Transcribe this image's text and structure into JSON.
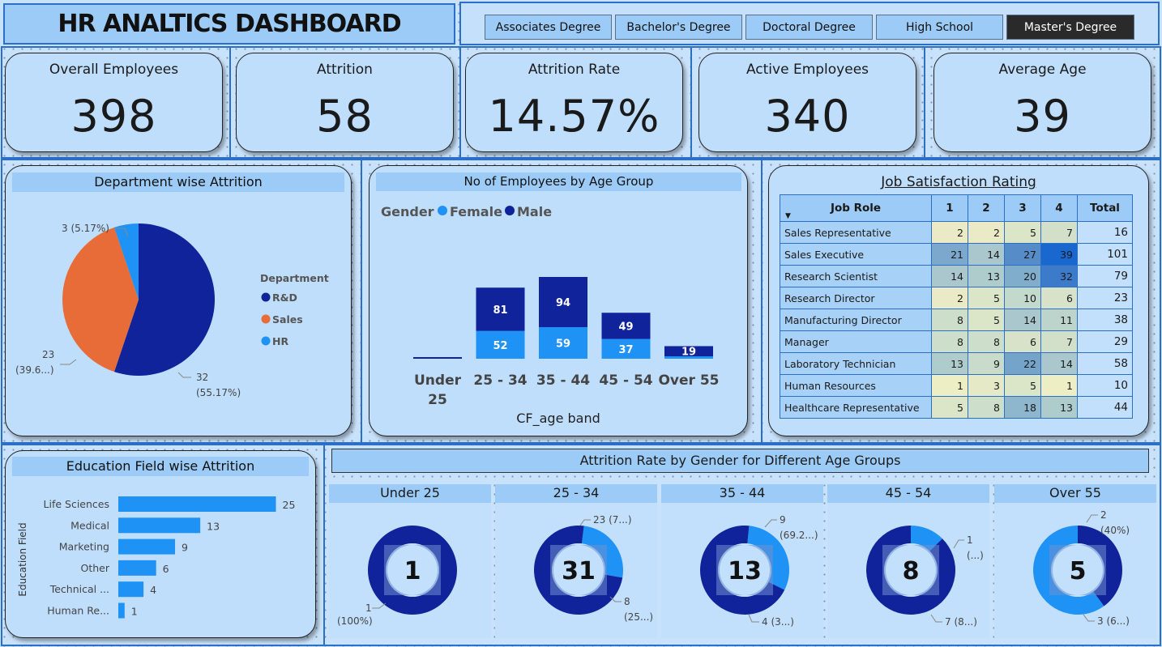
{
  "title": "HR ANALTICS DASHBOARD",
  "filters": [
    {
      "label": "Associates Degree",
      "selected": false
    },
    {
      "label": "Bachelor's Degree",
      "selected": false
    },
    {
      "label": "Doctoral Degree",
      "selected": false
    },
    {
      "label": "High School",
      "selected": false
    },
    {
      "label": "Master's Degree",
      "selected": true
    }
  ],
  "kpis": [
    {
      "label": "Overall Employees",
      "value": "398"
    },
    {
      "label": "Attrition",
      "value": "58"
    },
    {
      "label": "Attrition Rate",
      "value": "14.57%"
    },
    {
      "label": "Active Employees",
      "value": "340"
    },
    {
      "label": "Average Age",
      "value": "39"
    }
  ],
  "colors": {
    "rd": "#10239b",
    "sales": "#e86c38",
    "hr": "#1f93f5",
    "female": "#1f93f5",
    "male": "#10239b",
    "bar": "#1f93f5"
  },
  "dept": {
    "title": "Department wise Attrition",
    "legend_title": "Department",
    "legend": [
      "R&D",
      "Sales",
      "HR"
    ],
    "labels": {
      "hr": "3 (5.17%)",
      "sales_a": "23",
      "sales_b": "(39.6...)",
      "rd_a": "32",
      "rd_b": "(55.17%)"
    }
  },
  "age": {
    "title": "No of Employees by Age Group",
    "legend_title": "Gender",
    "legend": [
      "Female",
      "Male"
    ],
    "xlabel": "CF_age band"
  },
  "job": {
    "title": "Job Satisfaction Rating",
    "headers": [
      "Job Role",
      "1",
      "2",
      "3",
      "4",
      "Total"
    ],
    "rows": [
      {
        "role": "Sales Representative",
        "v": [
          2,
          2,
          5,
          7
        ],
        "total": 16
      },
      {
        "role": "Sales Executive",
        "v": [
          21,
          14,
          27,
          39
        ],
        "total": 101
      },
      {
        "role": "Research Scientist",
        "v": [
          14,
          13,
          20,
          32
        ],
        "total": 79
      },
      {
        "role": "Research Director",
        "v": [
          2,
          5,
          10,
          6
        ],
        "total": 23
      },
      {
        "role": "Manufacturing Director",
        "v": [
          8,
          5,
          14,
          11
        ],
        "total": 38
      },
      {
        "role": "Manager",
        "v": [
          8,
          8,
          6,
          7
        ],
        "total": 29
      },
      {
        "role": "Laboratory Technician",
        "v": [
          13,
          9,
          22,
          14
        ],
        "total": 58
      },
      {
        "role": "Human Resources",
        "v": [
          1,
          3,
          5,
          1
        ],
        "total": 10
      },
      {
        "role": "Healthcare Representative",
        "v": [
          5,
          8,
          18,
          13
        ],
        "total": 44
      }
    ]
  },
  "edu": {
    "title": "Education Field wise Attrition",
    "ylabel": "Education Field"
  },
  "gender": {
    "title": "Attrition Rate by Gender for Different Age Groups",
    "donuts": [
      {
        "name": "Under 25",
        "center": "1",
        "labels": {
          "b1": "1",
          "b2": "(100%)"
        }
      },
      {
        "name": "25 - 34",
        "center": "31",
        "labels": {
          "a1": "23 (7...)",
          "b1": "8",
          "b2": "(25...)"
        }
      },
      {
        "name": "35 - 44",
        "center": "13",
        "labels": {
          "a1": "9",
          "a2": "(69.2...)",
          "b1": "4 (3...)"
        }
      },
      {
        "name": "45 - 54",
        "center": "8",
        "labels": {
          "a1": "1",
          "a2": "(...)",
          "b1": "7 (8...)"
        }
      },
      {
        "name": "Over 55",
        "center": "5",
        "labels": {
          "a1": "2",
          "a2": "(40%)",
          "b1": "3 (6...)"
        }
      }
    ]
  },
  "chart_data": [
    {
      "type": "pie",
      "title": "Department wise Attrition",
      "categories": [
        "R&D",
        "Sales",
        "HR"
      ],
      "values": [
        32,
        23,
        3
      ],
      "legend_title": "Department"
    },
    {
      "type": "bar",
      "title": "No of Employees by Age Group",
      "xlabel": "CF_age band",
      "categories": [
        "Under 25",
        "25 - 34",
        "35 - 44",
        "45 - 54",
        "Over 55"
      ],
      "series": [
        {
          "name": "Female",
          "values": [
            0,
            52,
            59,
            37,
            2
          ]
        },
        {
          "name": "Male",
          "values": [
            1,
            81,
            94,
            49,
            19
          ]
        }
      ],
      "stacked": true
    },
    {
      "type": "bar",
      "title": "Education Field wise Attrition",
      "ylabel": "Education Field",
      "orientation": "horizontal",
      "categories": [
        "Life Sciences",
        "Medical",
        "Marketing",
        "Other",
        "Technical ...",
        "Human Re..."
      ],
      "values": [
        25,
        13,
        9,
        6,
        4,
        1
      ]
    },
    {
      "type": "pie",
      "title": "Under 25",
      "series": [
        {
          "name": "Male",
          "values": [
            1
          ]
        }
      ],
      "total": 1
    },
    {
      "type": "pie",
      "title": "25 - 34",
      "values": [
        23,
        8
      ],
      "total": 31
    },
    {
      "type": "pie",
      "title": "35 - 44",
      "values": [
        9,
        4
      ],
      "total": 13
    },
    {
      "type": "pie",
      "title": "45 - 54",
      "values": [
        1,
        7
      ],
      "total": 8
    },
    {
      "type": "pie",
      "title": "Over 55",
      "values": [
        2,
        3
      ],
      "total": 5
    }
  ]
}
